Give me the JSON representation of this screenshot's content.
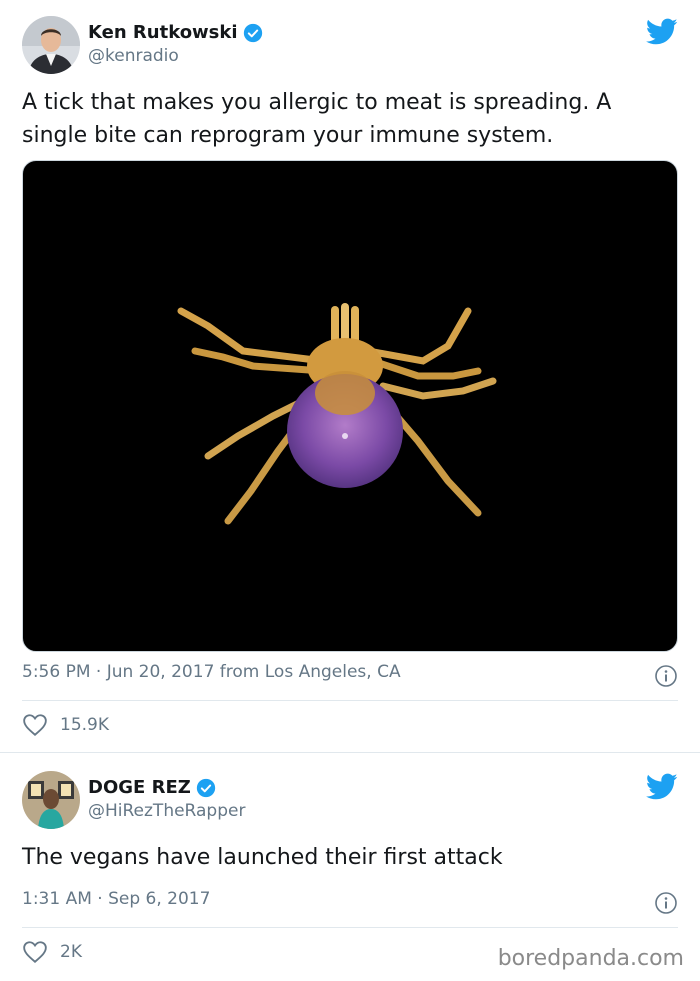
{
  "tweets": [
    {
      "name": "Ken Rutkowski",
      "handle": "@kenradio",
      "text": "A tick that makes you allergic to meat is spreading. A single bite can reprogram your immune system.",
      "timestamp": "5:56 PM · Jun 20, 2017 from Los Angeles, CA",
      "likes": "15.9K",
      "media_icon": "tick-photo"
    },
    {
      "name": "DOGE REZ",
      "handle": "@HiRezTheRapper",
      "text": "The vegans have launched their first attack",
      "timestamp": "1:31 AM · Sep 6, 2017",
      "likes": "2K"
    }
  ],
  "watermark": "boredpanda.com",
  "colors": {
    "twitter_blue": "#1da1f2",
    "secondary_text": "#657786"
  }
}
